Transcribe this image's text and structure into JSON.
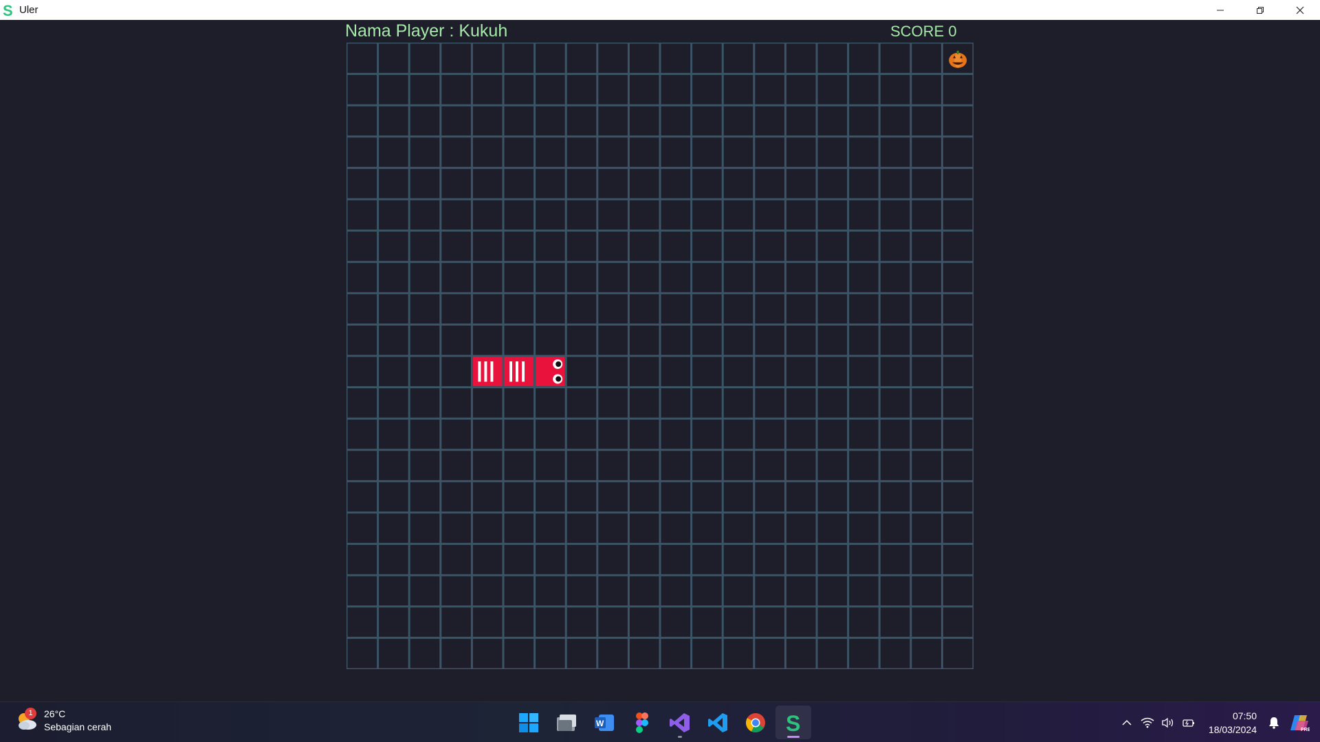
{
  "window": {
    "title": "Uler",
    "app_icon": "s-logo-icon",
    "controls": [
      "minimize-icon",
      "restore-icon",
      "close-icon"
    ]
  },
  "game": {
    "player_label": "Nama Player : Kukuh",
    "score_label": "SCORE 0",
    "grid": {
      "columns": 20,
      "rows": 20
    },
    "snake": {
      "color": "#e8123c",
      "head": {
        "col": 6,
        "row": 10
      },
      "body": [
        {
          "col": 5,
          "row": 10
        },
        {
          "col": 4,
          "row": 10
        }
      ]
    },
    "food": {
      "icon": "pumpkin-icon",
      "col": 19,
      "row": 0
    },
    "colors": {
      "background": "#1e1d2a",
      "grid_line": "#3b5466",
      "text": "#a6e9a8"
    }
  },
  "taskbar": {
    "weather": {
      "temp": "26°C",
      "desc": "Sebagian cerah",
      "badge": "1",
      "icon": "partly-cloudy-icon"
    },
    "apps": [
      {
        "name": "windows-start-icon"
      },
      {
        "name": "file-explorer-icon"
      },
      {
        "name": "word-icon"
      },
      {
        "name": "figma-icon"
      },
      {
        "name": "visual-studio-icon"
      },
      {
        "name": "vscode-icon"
      },
      {
        "name": "chrome-icon"
      },
      {
        "name": "uler-app-icon"
      }
    ],
    "tray": [
      "chevron-up-icon",
      "wifi-icon",
      "volume-icon",
      "battery-icon"
    ],
    "clock": {
      "time": "07:50",
      "date": "18/03/2024"
    }
  }
}
